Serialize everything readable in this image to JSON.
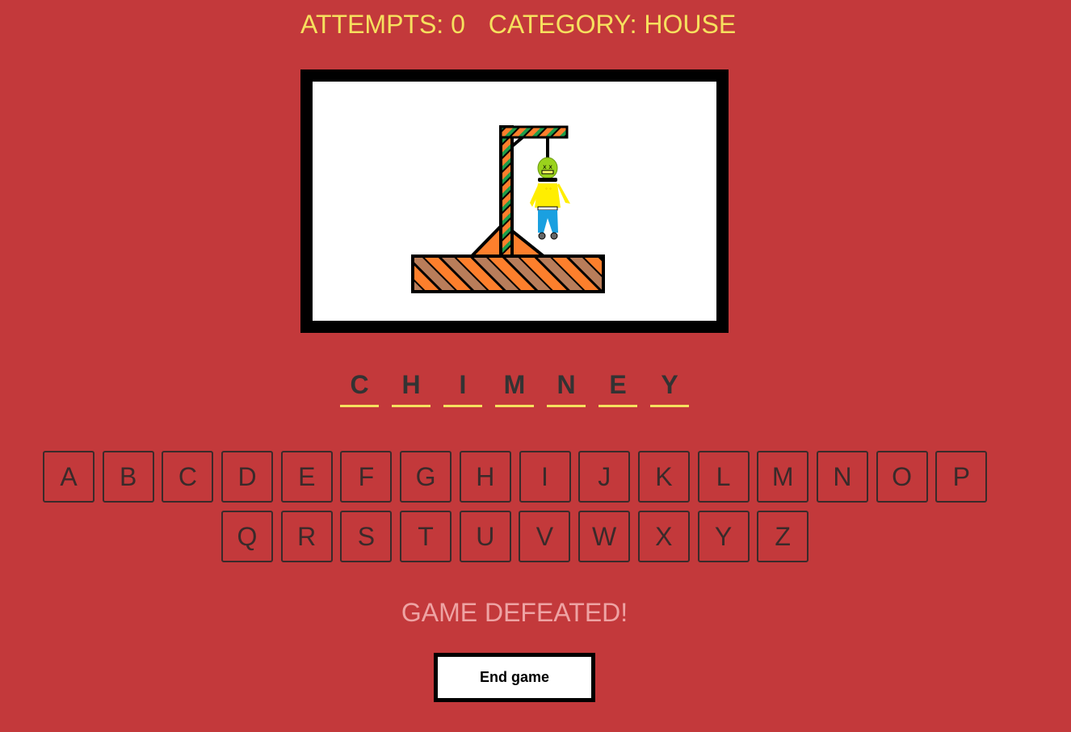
{
  "header": {
    "attempts": "ATTEMPTS: 0",
    "category": "CATEGORY: HOUSE"
  },
  "word": [
    "C",
    "H",
    "I",
    "M",
    "N",
    "E",
    "Y"
  ],
  "keyboard": {
    "row1": [
      "A",
      "B",
      "C",
      "D",
      "E",
      "F",
      "G",
      "H",
      "I",
      "J",
      "K",
      "L",
      "M",
      "N",
      "O",
      "P"
    ],
    "row2": [
      "Q",
      "R",
      "S",
      "T",
      "U",
      "V",
      "W",
      "X",
      "Y",
      "Z"
    ]
  },
  "status": "GAME DEFEATED!",
  "end_button": "End game",
  "colors": {
    "background": "#c3393b",
    "accent": "#f6e05e",
    "gallows_orange": "#fd7f2c",
    "gallows_green": "#1e9e4a",
    "platform_brown": "#b97d5a",
    "shirt_yellow": "#ffee00",
    "pants_blue": "#1aa0e0",
    "head_green": "#9ad21c"
  }
}
